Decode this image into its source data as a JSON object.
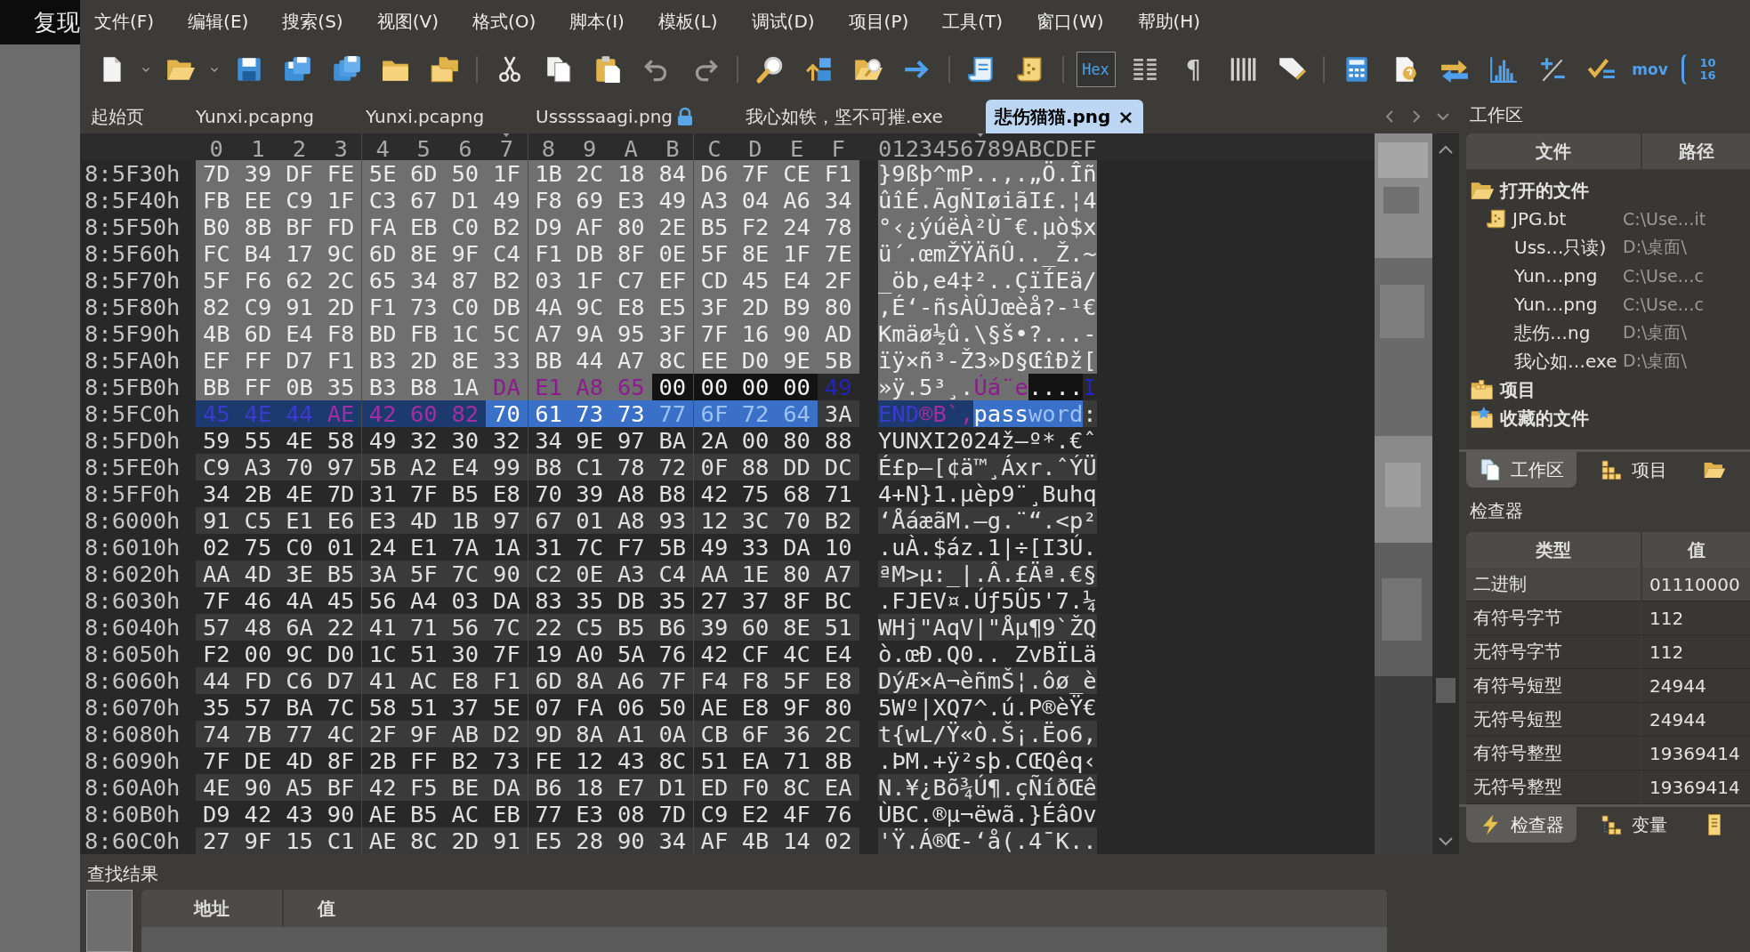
{
  "background_window": {
    "text": "复现"
  },
  "menu": [
    "文件(F)",
    "编辑(E)",
    "搜索(S)",
    "视图(V)",
    "格式(O)",
    "脚本(I)",
    "模板(L)",
    "调试(D)",
    "项目(P)",
    "工具(T)",
    "窗口(W)",
    "帮助(H)"
  ],
  "toolbar": {
    "hex_toggle": {
      "label": "Hex",
      "on": true
    },
    "pilcrow": "¶",
    "mov": "mov",
    "base": [
      "10",
      "16"
    ]
  },
  "tabs": [
    {
      "label": "起始页",
      "selected": false,
      "locked": false
    },
    {
      "label": "Yunxi.pcapng",
      "selected": false,
      "locked": false
    },
    {
      "label": "Yunxi.pcapng",
      "selected": false,
      "locked": false
    },
    {
      "label": "Usssssaagi.png",
      "selected": false,
      "locked": true
    },
    {
      "label": "我心如铁，坚不可摧.exe",
      "selected": false,
      "locked": false
    },
    {
      "label": "悲伤猫猫.png",
      "selected": true,
      "locked": false,
      "close": "×"
    }
  ],
  "hex_view": {
    "columns": [
      {
        "label": "0",
        "current": false
      },
      {
        "label": "1",
        "current": false
      },
      {
        "label": "2",
        "current": false
      },
      {
        "label": "3",
        "current": false
      },
      {
        "label": "4",
        "current": false
      },
      {
        "label": "5",
        "current": false
      },
      {
        "label": "6",
        "current": false
      },
      {
        "label": "7",
        "current": true
      },
      {
        "label": "8",
        "current": false
      },
      {
        "label": "9",
        "current": false
      },
      {
        "label": "A",
        "current": false
      },
      {
        "label": "B",
        "current": false
      },
      {
        "label": "C",
        "current": false
      },
      {
        "label": "D",
        "current": false
      },
      {
        "label": "E",
        "current": false
      },
      {
        "label": "F",
        "current": false
      }
    ],
    "ascii_header": "0123456789ABCDEF",
    "rows": [
      {
        "offset": "8:5F30h",
        "hex": "7D 39 DF FE 5E 6D 50 1F 1B 2C 18 84 D6 7F CE F1",
        "ascii": "}9ßþ^mP..,.„Ö.Îñ",
        "selected": true
      },
      {
        "offset": "8:5F40h",
        "hex": "FB EE C9 1F C3 67 D1 49 F8 69 E3 49 A3 04 A6 34",
        "ascii": "ûîÉ.ÃgÑIøiãI£.¦4",
        "selected": true
      },
      {
        "offset": "8:5F50h",
        "hex": "B0 8B BF FD FA EB C0 B2 D9 AF 80 2E B5 F2 24 78",
        "ascii": "°‹¿ýúëÀ²Ù¯€.µò$x",
        "selected": true
      },
      {
        "offset": "8:5F60h",
        "hex": "FC B4 17 9C 6D 8E 9F C4 F1 DB 8F 0E 5F 8E 1F 7E",
        "ascii": "ü´.œmŽŸÄñÛ.._Ž.~",
        "selected": true
      },
      {
        "offset": "8:5F70h",
        "hex": "5F F6 62 2C 65 34 87 B2 03 1F C7 EF CD 45 E4 2F",
        "ascii": "_öb,e4‡²..ÇïÍEä/",
        "selected": true
      },
      {
        "offset": "8:5F80h",
        "hex": "82 C9 91 2D F1 73 C0 DB 4A 9C E8 E5 3F 2D B9 80",
        "ascii": "‚É‘-ñsÀÛJœèå?-¹€",
        "selected": true
      },
      {
        "offset": "8:5F90h",
        "hex": "4B 6D E4 F8 BD FB 1C 5C A7 9A 95 3F 7F 16 90 AD",
        "ascii": "Kmäø½û.\\§š•?...-",
        "selected": true
      },
      {
        "offset": "8:5FA0h",
        "hex": "EF FF D7 F1 B3 2D 8E 33 BB 44 A7 8C EE D0 9E 5B",
        "ascii": "ïÿ×ñ³-Ž3»D§ŒîÐž[",
        "selected": true
      },
      {
        "offset": "8:5FB0h",
        "selected": false,
        "hex_runs": [
          {
            "bytes": "BB FF 0B 35 B3 B8 1A",
            "kind": "selection"
          },
          {
            "bytes": "DA E1 A8 65",
            "kind": "selection-var"
          },
          {
            "bytes": "00 00 00 00",
            "kind": "dark"
          },
          {
            "bytes": "49",
            "kind": "var-blue"
          }
        ],
        "ascii_runs": [
          {
            "text": "»ÿ.5³¸.",
            "kind": "selection"
          },
          {
            "text": "Úá¨e",
            "kind": "selection-var"
          },
          {
            "text": "....",
            "kind": "dark"
          },
          {
            "text": "I",
            "kind": "var-blue"
          }
        ]
      },
      {
        "offset": "8:5FC0h",
        "selected": false,
        "hex_runs": [
          {
            "bytes": "45 4E 44",
            "kind": "found"
          },
          {
            "bytes": "AE 42 60 82",
            "kind": "found-var"
          },
          {
            "bytes": "70 61 73 73",
            "kind": "cursor"
          },
          {
            "bytes": "77 6F 72 64",
            "kind": "cursor-dim"
          },
          {
            "bytes": "3A",
            "kind": "plain"
          }
        ],
        "ascii_runs": [
          {
            "text": "END",
            "kind": "found"
          },
          {
            "text": "®B`‚",
            "kind": "found-var"
          },
          {
            "text": "pass",
            "kind": "cursor"
          },
          {
            "text": "word",
            "kind": "cursor-dim"
          },
          {
            "text": ":",
            "kind": "plain"
          }
        ]
      },
      {
        "offset": "8:5FD0h",
        "hex": "59 55 4E 58 49 32 30 32 34 9E 97 BA 2A 00 80 88",
        "ascii": "YUNXI2024ž—º*.€ˆ",
        "selected": false
      },
      {
        "offset": "8:5FE0h",
        "hex": "C9 A3 70 97 5B A2 E4 99 B8 C1 78 72 0F 88 DD DC",
        "ascii": "É£p—[¢ä™¸Áxr.ˆÝÜ",
        "selected": false
      },
      {
        "offset": "8:5FF0h",
        "hex": "34 2B 4E 7D 31 7F B5 E8 70 39 A8 B8 42 75 68 71",
        "ascii": "4+N}1.µèp9¨¸Buhq",
        "selected": false
      },
      {
        "offset": "8:6000h",
        "hex": "91 C5 E1 E6 E3 4D 1B 97 67 01 A8 93 12 3C 70 B2",
        "ascii": "‘ÅáæãM.—g.¨“.<p²",
        "selected": false
      },
      {
        "offset": "8:6010h",
        "hex": "02 75 C0 01 24 E1 7A 1A 31 7C F7 5B 49 33 DA 10",
        "ascii": ".uÀ.$áz.1|÷[I3Ú.",
        "selected": false
      },
      {
        "offset": "8:6020h",
        "hex": "AA 4D 3E B5 3A 5F 7C 90 C2 0E A3 C4 AA 1E 80 A7",
        "ascii": "ªM>µ:_|.Â.£Äª.€§",
        "selected": false
      },
      {
        "offset": "8:6030h",
        "hex": "7F 46 4A 45 56 A4 03 DA 83 35 DB 35 27 37 8F BC",
        "ascii": ".FJEV¤.Úƒ5Û5'7.¼",
        "selected": false
      },
      {
        "offset": "8:6040h",
        "hex": "57 48 6A 22 41 71 56 7C 22 C5 B5 B6 39 60 8E 51",
        "ascii": "WHj\"AqV|\"Åµ¶9`ŽQ",
        "selected": false
      },
      {
        "offset": "8:6050h",
        "hex": "F2 00 9C D0 1C 51 30 7F 19 A0 5A 76 42 CF 4C E4",
        "ascii": "ò.œÐ.Q0.. ZvBÏLä",
        "selected": false
      },
      {
        "offset": "8:6060h",
        "hex": "44 FD C6 D7 41 AC E8 F1 6D 8A A6 7F F4 F8 5F E8",
        "ascii": "DýÆ×A¬èñmŠ¦.ôø_è",
        "selected": false
      },
      {
        "offset": "8:6070h",
        "hex": "35 57 BA 7C 58 51 37 5E 07 FA 06 50 AE E8 9F 80",
        "ascii": "5Wº|XQ7^.ú.P®èŸ€",
        "selected": false
      },
      {
        "offset": "8:6080h",
        "hex": "74 7B 77 4C 2F 9F AB D2 9D 8A A1 0A CB 6F 36 2C",
        "ascii": "t{wL/Ÿ«Ò.Š¡.Ëo6,",
        "selected": false
      },
      {
        "offset": "8:6090h",
        "hex": "7F DE 4D 8F 2B FF B2 73 FE 12 43 8C 51 EA 71 8B",
        "ascii": ".ÞM.+ÿ²sþ.CŒQêq‹",
        "selected": false
      },
      {
        "offset": "8:60A0h",
        "hex": "4E 90 A5 BF 42 F5 BE DA B6 18 E7 D1 ED F0 8C EA",
        "ascii": "N.¥¿Bõ¾Ú¶.çÑíðŒê",
        "selected": false
      },
      {
        "offset": "8:60B0h",
        "hex": "D9 42 43 90 AE B5 AC EB 77 E3 08 7D C9 E2 4F 76",
        "ascii": "ÙBC.®µ¬ëwã.}ÉâOv",
        "selected": false
      },
      {
        "offset": "8:60C0h",
        "hex": "27 9F 15 C1 AE 8C 2D 91 E5 28 90 34 AF 4B 14 02",
        "ascii": "'Ÿ.Á®Œ-‘å(.4¯K..",
        "selected": false
      }
    ]
  },
  "workspace": {
    "title": "工作区",
    "columns": [
      "文件",
      "路径"
    ],
    "tree": [
      {
        "label": "打开的文件",
        "kind": "open-files",
        "children": [
          {
            "name": "JPG.bt",
            "path": "C:\\Use…it",
            "kind": "template"
          },
          {
            "name": "Uss…只读)",
            "path": "D:\\桌面\\",
            "kind": "file"
          },
          {
            "name": "Yun…png",
            "path": "C:\\Use…c",
            "kind": "file"
          },
          {
            "name": "Yun…png",
            "path": "C:\\Use…c",
            "kind": "file"
          },
          {
            "name": "悲伤…ng",
            "path": "D:\\桌面\\",
            "kind": "file"
          },
          {
            "name": "我心如…exe",
            "path": "D:\\桌面\\",
            "kind": "file"
          }
        ]
      },
      {
        "label": "项目",
        "kind": "project"
      },
      {
        "label": "收藏的文件",
        "kind": "favorites"
      }
    ],
    "tabs": [
      {
        "label": "工作区",
        "kind": "workspace",
        "selected": true
      },
      {
        "label": "项目",
        "kind": "project",
        "selected": false
      },
      {
        "kind": "folder",
        "selected": false
      }
    ]
  },
  "inspector": {
    "title": "检查器",
    "columns": [
      "类型",
      "值"
    ],
    "rows": [
      {
        "type": "二进制",
        "value": "01110000",
        "selected": true
      },
      {
        "type": "有符号字节",
        "value": "112",
        "selected": false
      },
      {
        "type": "无符号字节",
        "value": "112",
        "selected": false
      },
      {
        "type": "有符号短型",
        "value": "24944",
        "selected": false
      },
      {
        "type": "无符号短型",
        "value": "24944",
        "selected": false
      },
      {
        "type": "有符号整型",
        "value": "19369414",
        "selected": false
      },
      {
        "type": "无符号整型",
        "value": "19369414",
        "selected": false
      }
    ],
    "tabs": [
      {
        "label": "检查器",
        "kind": "inspector",
        "selected": true
      },
      {
        "label": "变量",
        "kind": "variables",
        "selected": false
      },
      {
        "kind": "bookmarks",
        "selected": false
      }
    ]
  },
  "find_results": {
    "title": "查找结果",
    "columns": [
      "地址",
      "值"
    ]
  }
}
